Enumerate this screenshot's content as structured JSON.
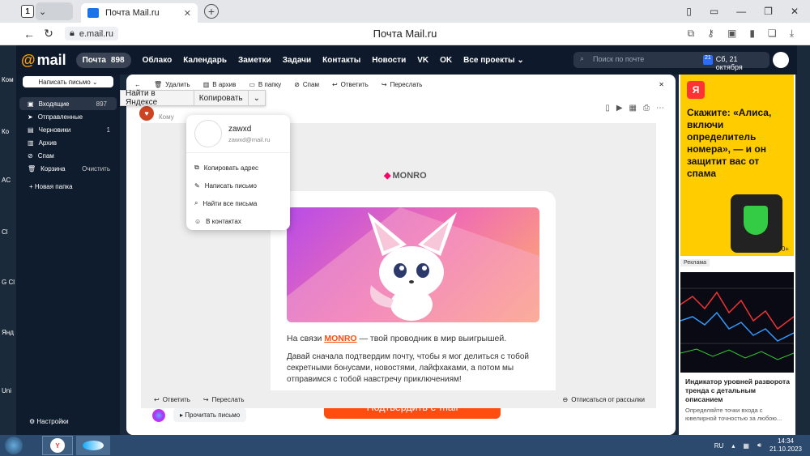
{
  "browser": {
    "tab_count": "1",
    "tab_title": "Почта Mail.ru",
    "url": "e.mail.ru",
    "page_title": "Почта Mail.ru"
  },
  "mailnav": {
    "logo": "mail",
    "inbox_label": "Почта",
    "inbox_count": "898",
    "links": [
      "Облако",
      "Календарь",
      "Заметки",
      "Задачи",
      "Контакты",
      "Новости",
      "VK",
      "OK",
      "Все проекты"
    ],
    "search_placeholder": "Поиск по почте",
    "date": "Сб, 21 октября",
    "calendar_day": "21"
  },
  "sidebar": {
    "compose": "Написать письмо",
    "items": [
      {
        "label": "Входящие",
        "count": "897"
      },
      {
        "label": "Отправленные",
        "count": ""
      },
      {
        "label": "Черновики",
        "count": "1"
      },
      {
        "label": "Архив",
        "count": ""
      },
      {
        "label": "Спам",
        "count": ""
      },
      {
        "label": "Корзина",
        "count": "Очистить"
      }
    ],
    "new_folder": "Новая папка",
    "settings": "Настройки"
  },
  "toolbar": {
    "delete": "Удалить",
    "archive": "В архив",
    "folder": "В папку",
    "spam": "Спам",
    "reply": "Ответить",
    "forward": "Переслать"
  },
  "header": {
    "to_label": "Кому"
  },
  "context_bar": {
    "find": "Найти в Яндексе",
    "copy": "Копировать"
  },
  "popup": {
    "name": "zawxd",
    "email": "zawxd@mail.ru",
    "items": [
      "Копировать адрес",
      "Написать письмо",
      "Найти все письма",
      "В контактах"
    ]
  },
  "letter": {
    "brand": "MONRO",
    "intro_prefix": "На связи ",
    "intro_brand": "MONRO",
    "intro_suffix": " — твой проводник в мир выигрышей.",
    "paragraph": "Давай сначала подтвердим почту, чтобы я мог делиться с тобой секретными бонусами, новостями, лайфхаками, а потом мы отправимся с тобой навстречу приключениям!",
    "cta": "Подтвердить e-mail"
  },
  "bottom": {
    "reply": "Ответить",
    "forward": "Переслать",
    "unsubscribe": "Отписаться от рассылки",
    "read": "Прочитать письмо"
  },
  "ads": {
    "ya_badge": "Я",
    "ad1_text": "Скажите: «Алиса, включи определитель номера», — и он защитит вас от спама",
    "ad1_age": "0+",
    "ad_label": "Реклама",
    "ad2_title": "Индикатор уровней разворота тренда с детальным описанием",
    "ad2_desc": "Определяйте точки входа с ювелирной точностью за любою..."
  },
  "desktop_labels": [
    "Ком",
    "Ко",
    "AC",
    "Cl",
    "G Cl",
    "Янд",
    "Uni"
  ],
  "taskbar": {
    "lang": "RU",
    "time": "14:34",
    "date": "21.10.2023",
    "ya": "Y"
  },
  "colors": {
    "accent": "#ff4d10",
    "nav_bg": "#0e1a2b",
    "ad_yellow": "#ffcc00"
  }
}
